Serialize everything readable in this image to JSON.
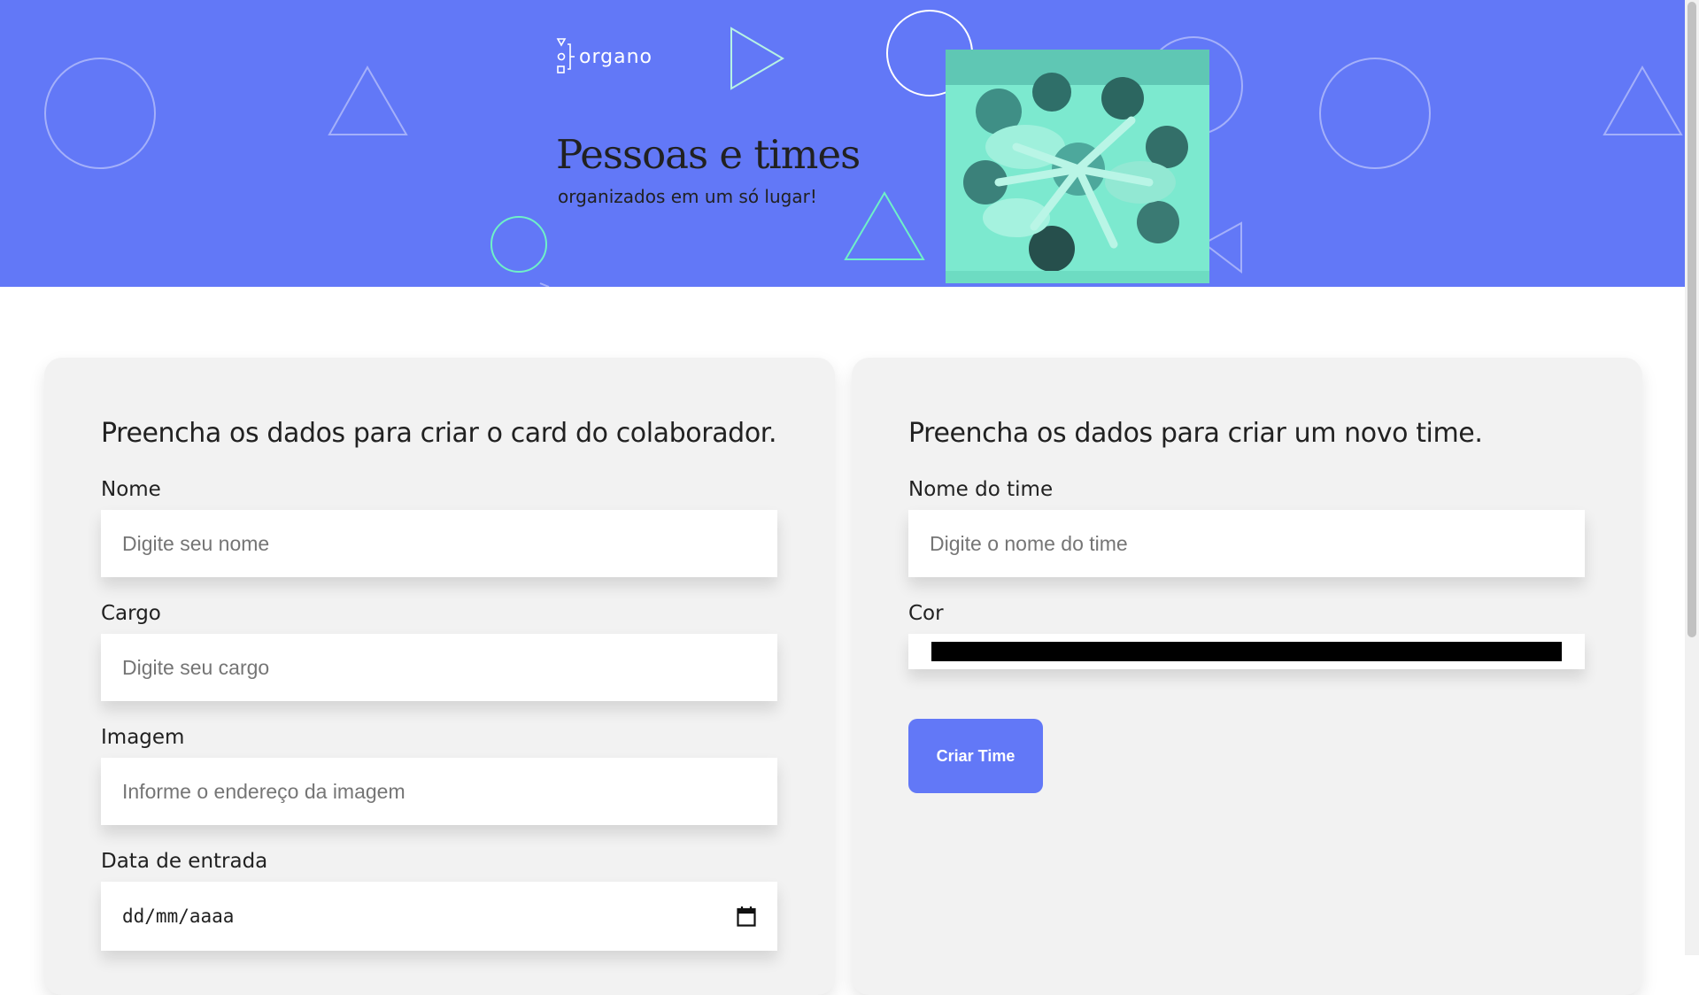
{
  "header": {
    "logo_text": "organo",
    "title": "Pessoas e times",
    "subtitle": "organizados em um só lugar!",
    "background_color": "#6278f7",
    "decor_stroke_color": "#a4b0fa",
    "decor_accent_color": "#6ff0c8",
    "photo_tint_color": "#7ce9cf",
    "photo_icon": "team-hands-together-photo"
  },
  "collaborator_form": {
    "title": "Preencha os dados para criar o card do colaborador.",
    "name_label": "Nome",
    "name_placeholder": "Digite seu nome",
    "role_label": "Cargo",
    "role_placeholder": "Digite seu cargo",
    "image_label": "Imagem",
    "image_placeholder": "Informe o endereço da imagem",
    "date_label": "Data de entrada",
    "date_value": "dd/mm/aaaa",
    "date_icon": "calendar-icon"
  },
  "team_form": {
    "title": "Preencha os dados para criar um novo time.",
    "team_name_label": "Nome do time",
    "team_name_placeholder": "Digite o nome do time",
    "color_label": "Cor",
    "color_value": "#000000",
    "submit_label": "Criar Time",
    "button_color": "#6278f7"
  }
}
